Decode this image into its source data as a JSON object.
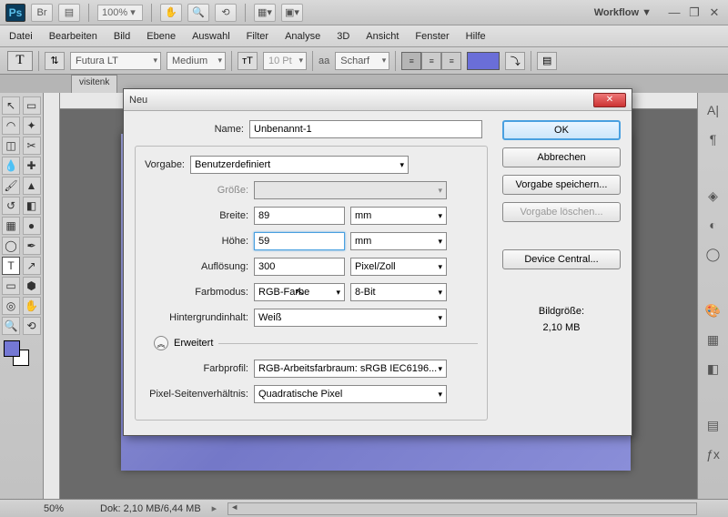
{
  "sysbar": {
    "zoom": "100% ▾",
    "workflow": "Workflow ▼"
  },
  "menu": [
    "Datei",
    "Bearbeiten",
    "Bild",
    "Ebene",
    "Auswahl",
    "Filter",
    "Analyse",
    "3D",
    "Ansicht",
    "Fenster",
    "Hilfe"
  ],
  "options": {
    "font": "Futura LT",
    "weight": "Medium",
    "size": "10 Pt",
    "aa_label": "aa",
    "aa_text": "Scharf"
  },
  "tab": "visitenk",
  "status": {
    "zoom": "50%",
    "dok": "Dok: 2,10 MB/6,44 MB"
  },
  "dialog": {
    "title": "Neu",
    "labels": {
      "name": "Name:",
      "vorgabe": "Vorgabe:",
      "groesse": "Größe:",
      "breite": "Breite:",
      "hoehe": "Höhe:",
      "aufloesung": "Auflösung:",
      "farbmodus": "Farbmodus:",
      "hintergrund": "Hintergrundinhalt:",
      "erweitert": "Erweitert",
      "farbprofil": "Farbprofil:",
      "pixelsv": "Pixel-Seitenverhältnis:"
    },
    "values": {
      "name": "Unbenannt-1",
      "vorgabe": "Benutzerdefiniert",
      "groesse": "",
      "breite": "89",
      "breite_unit": "mm",
      "hoehe": "59",
      "hoehe_unit": "mm",
      "aufloesung": "300",
      "aufloesung_unit": "Pixel/Zoll",
      "farbmodus": "RGB-Farbe",
      "farbmodus_bit": "8-Bit",
      "hintergrund": "Weiß",
      "farbprofil": "RGB-Arbeitsfarbraum: sRGB IEC6196...",
      "pixelsv": "Quadratische Pixel"
    },
    "buttons": {
      "ok": "OK",
      "abbrechen": "Abbrechen",
      "speichern": "Vorgabe speichern...",
      "loeschen": "Vorgabe löschen...",
      "device": "Device Central..."
    },
    "imgsize": {
      "label": "Bildgröße:",
      "value": "2,10 MB"
    }
  }
}
